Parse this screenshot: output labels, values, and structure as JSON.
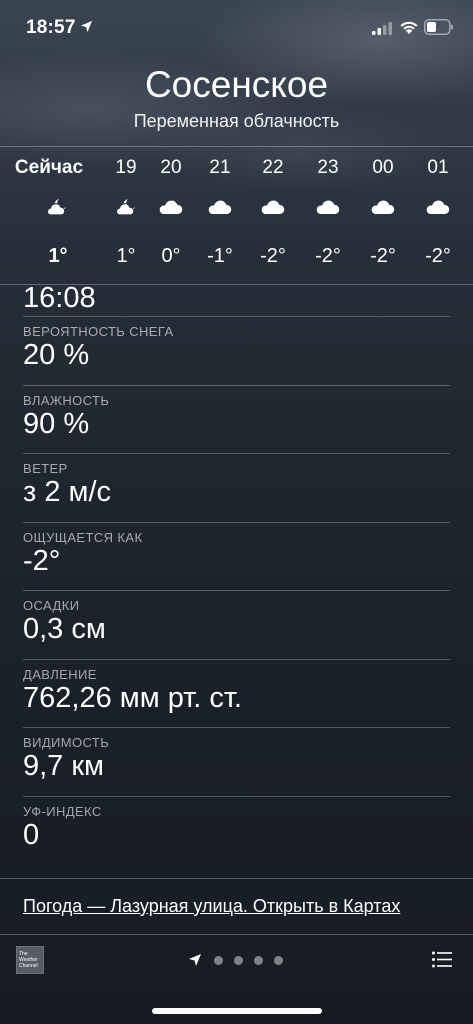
{
  "status_bar": {
    "time": "18:57"
  },
  "header": {
    "city": "Сосенское",
    "condition": "Переменная облачность"
  },
  "hourly": [
    {
      "label": "Сейчас",
      "temp": "1°",
      "icon": "moon-cloud-icon"
    },
    {
      "label": "19",
      "temp": "1°",
      "icon": "moon-cloud-icon"
    },
    {
      "label": "20",
      "temp": "0°",
      "icon": "cloud-icon"
    },
    {
      "label": "21",
      "temp": "-1°",
      "icon": "cloud-icon"
    },
    {
      "label": "22",
      "temp": "-2°",
      "icon": "cloud-icon"
    },
    {
      "label": "23",
      "temp": "-2°",
      "icon": "cloud-icon"
    },
    {
      "label": "00",
      "temp": "-2°",
      "icon": "cloud-icon"
    },
    {
      "label": "01",
      "temp": "-2°",
      "icon": "cloud-icon"
    }
  ],
  "details": {
    "partial_value": "16:08",
    "rows": [
      {
        "label": "ВЕРОЯТНОСТЬ СНЕГА",
        "value": "20 %"
      },
      {
        "label": "ВЛАЖНОСТЬ",
        "value": "90 %"
      },
      {
        "label": "ВЕТЕР",
        "value": "з 2 м/с"
      },
      {
        "label": "ОЩУЩАЕТСЯ КАК",
        "value": "-2°"
      },
      {
        "label": "ОСАДКИ",
        "value": "0,3 см"
      },
      {
        "label": "ДАВЛЕНИЕ",
        "value": "762,26 мм рт. ст."
      },
      {
        "label": "ВИДИМОСТЬ",
        "value": "9,7 км"
      },
      {
        "label": "УФ-ИНДЕКС",
        "value": "0"
      }
    ]
  },
  "footer": {
    "maps_link": "Погода — Лазурная улица. Открыть в Картах",
    "twc_logo_text": "The Weather Channel"
  },
  "colors": {
    "background_top": "#3a4552",
    "background_bottom": "#171c23",
    "text": "#ffffff"
  }
}
